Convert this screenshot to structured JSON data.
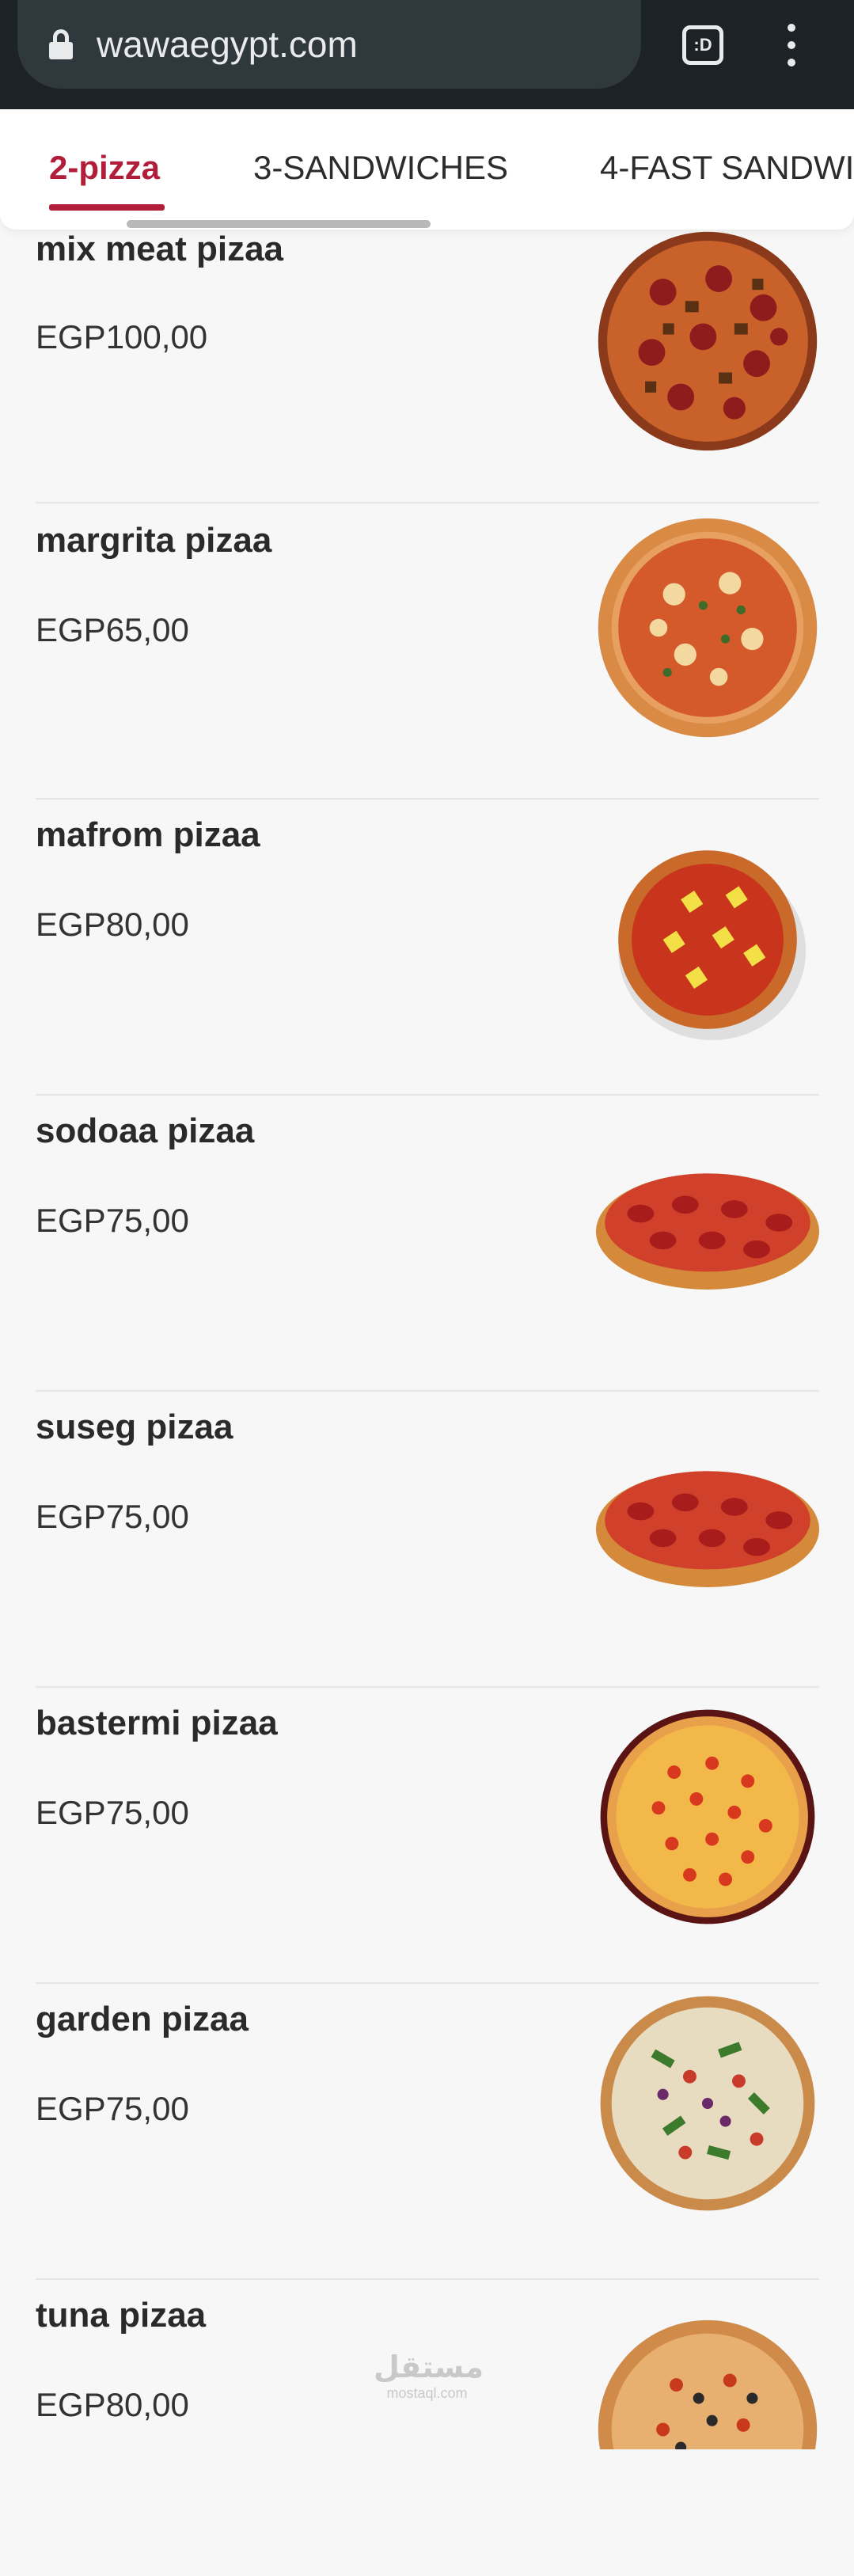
{
  "browser": {
    "url": "wawaegypt.com",
    "tab_switcher_label": ":D"
  },
  "tabs": [
    {
      "label": "2-pizza",
      "active": true
    },
    {
      "label": "3-SANDWICHES",
      "active": false
    },
    {
      "label": "4-FAST SANDWI",
      "active": false
    }
  ],
  "items": [
    {
      "name": "mix meat pizaa",
      "price": "EGP100,00",
      "image": "pizza-mixmeat"
    },
    {
      "name": "margrita pizaa",
      "price": "EGP65,00",
      "image": "pizza-margherita"
    },
    {
      "name": "mafrom pizaa",
      "price": "EGP80,00",
      "image": "pizza-pineapple"
    },
    {
      "name": "sodoaa pizaa",
      "price": "EGP75,00",
      "image": "pizza-pepperoni"
    },
    {
      "name": "suseg pizaa",
      "price": "EGP75,00",
      "image": "pizza-pepperoni"
    },
    {
      "name": "bastermi pizaa",
      "price": "EGP75,00",
      "image": "pizza-bastermi"
    },
    {
      "name": "garden pizaa",
      "price": "EGP75,00",
      "image": "pizza-garden"
    },
    {
      "name": "tuna pizaa",
      "price": "EGP80,00",
      "image": "pizza-tuna"
    }
  ],
  "watermark": {
    "arabic": "مستقل",
    "latin": "mostaql.com"
  },
  "colors": {
    "accent": "#b01e3a",
    "browser_bar": "#1c2226",
    "url_pill": "#2e383d"
  }
}
